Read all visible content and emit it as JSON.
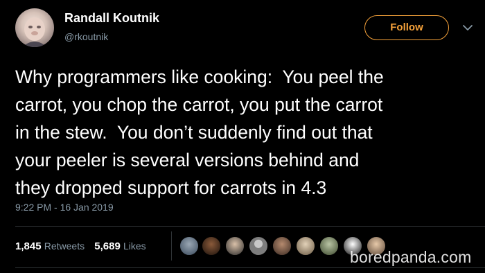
{
  "tweet": {
    "author": {
      "display_name": "Randall Koutnik",
      "handle": "@rkoutnik",
      "avatar_icon": "profile-photo"
    },
    "follow_label": "Follow",
    "text_lines": [
      "Why programmers like cooking:  You peel the",
      "carrot, you chop the carrot, you put the carrot",
      "in the stew.  You don’t suddenly find out that",
      "your peeler is several versions behind and",
      "they dropped support for carrots in 4.3"
    ],
    "timestamp": "9:22 PM - 16 Jan 2019",
    "stats": {
      "retweets_count": "1,845",
      "retweets_label": "Retweets",
      "likes_count": "5,689",
      "likes_label": "Likes"
    }
  },
  "watermark": "boredpanda.com",
  "colors": {
    "background": "#000000",
    "primary_text": "#ffffff",
    "secondary_text": "#8899a6",
    "follow_accent": "#f4a13a",
    "divider": "#2f3336"
  }
}
